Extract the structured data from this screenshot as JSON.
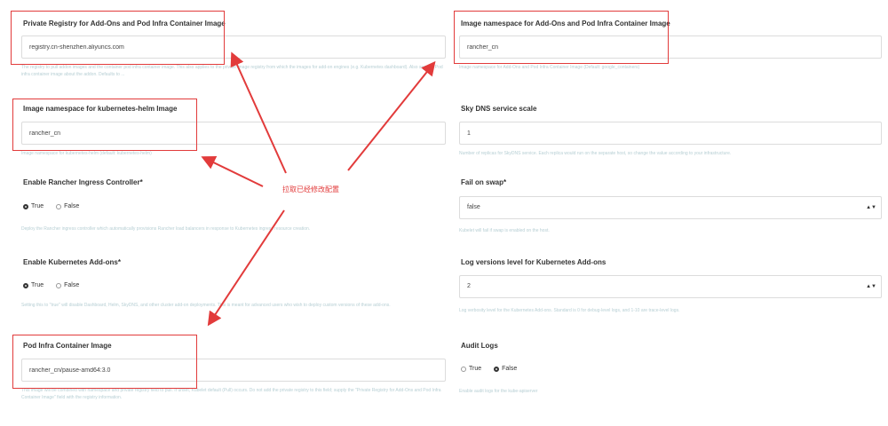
{
  "left": {
    "registry": {
      "label": "Private Registry for Add-Ons and Pod Infra Container Image",
      "value": "registry.cn-shenzhen.aliyuncs.com",
      "help": "The registry to pull addon images and the container pod infra container image. This also applies to the private image registry from which the images for add-on engines (e.g. Kubernetes dashboard). Also see the Pod infra container image about the addon. Defaults to ..."
    },
    "helm_namespace": {
      "label": "Image namespace for kubernetes-helm Image",
      "value": "rancher_cn",
      "help": "Image namespace for kubernetes-helm (default: kubernetes-helm)"
    },
    "ingress": {
      "label": "Enable Rancher Ingress Controller*",
      "options": [
        "True",
        "False"
      ],
      "selected": "True",
      "help": "Deploy the Rancher ingress controller which automatically provisions Rancher load balancers in response to Kubernetes ingress resource creation."
    },
    "addons": {
      "label": "Enable Kubernetes Add-ons*",
      "options": [
        "True",
        "False"
      ],
      "selected": "True",
      "help": "Setting this to \"true\" will disable Dashboard, Helm, SkyDNS, and other cluster add-on deployments. This is meant for advanced users who wish to deploy custom versions of these add-ons."
    },
    "pod_infra": {
      "label": "Pod Infra Container Image",
      "value": "rancher_cn/pause-amd64:3.0",
      "help": "This image will be combined with namespace and private registry field to pull. If unset, Kubelet default (Pull) occurs. Do not add the private registry to this field; supply the \"Private Registry for Add-Ons and Pod Infra Container Image\" field with the registry information."
    }
  },
  "right": {
    "image_namespace": {
      "label": "Image namespace for Add-Ons and Pod Infra Container Image",
      "value": "rancher_cn",
      "help": "Image namespace for Add-Ons and Pod Infra Container Image (Default: google_containers)"
    },
    "skydns": {
      "label": "Sky DNS service scale",
      "value": "1",
      "help": "Number of replicas for SkyDNS service. Each replica would run on the separate host, so change the value according to your infrastructure."
    },
    "fail_on_swap": {
      "label": "Fail on swap*",
      "value": "false",
      "help": "Kubelet will fail if swap is enabled on the host."
    },
    "log_level": {
      "label": "Log versions level for Kubernetes Add-ons",
      "value": "2",
      "help": "Log verbosity level for the Kubernetes Add-ons. Standard is 0 for debug-level logs, and 1-10 are trace-level logs."
    },
    "audit_logs": {
      "label": "Audit Logs",
      "options": [
        "True",
        "False"
      ],
      "selected": "False",
      "help": "Enable audit logs for the kube-apiserver"
    }
  },
  "annotation": {
    "text": "拉取已经修改配置"
  },
  "colors": {
    "highlight": "#e23b3b",
    "help_text": "#7fb5b5"
  }
}
